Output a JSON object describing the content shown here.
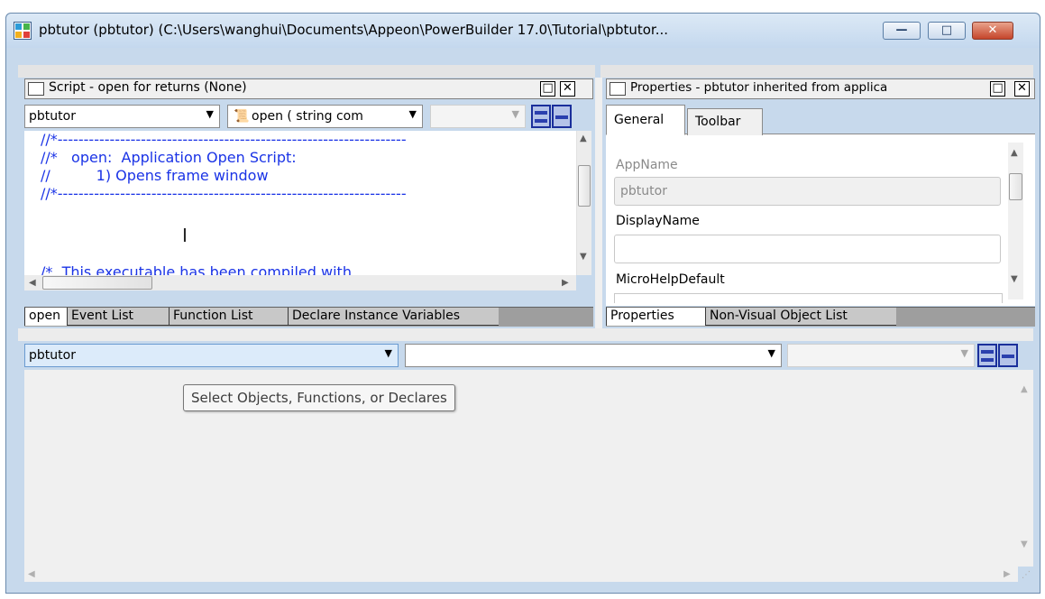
{
  "window": {
    "title": "pbtutor (pbtutor) (C:\\Users\\wanghui\\Documents\\Appeon\\PowerBuilder 17.0\\Tutorial\\pbtutor...",
    "minimize_glyph": "—",
    "maximize_glyph": "□",
    "close_glyph": "✕"
  },
  "script_pane": {
    "title": "Script - open for  returns (None)",
    "object_combo": "pbtutor",
    "event_combo": "open ( string com",
    "third_combo": "",
    "code_lines": [
      "//*-------------------------------------------------------------------",
      "//*   open:  Application Open Script:",
      "//          1) Opens frame window",
      "//*-------------------------------------------------------------------",
      "",
      "/*  This executable has been compiled with"
    ],
    "tabs": [
      "open",
      "Event List",
      "Function List",
      "Declare Instance Variables"
    ]
  },
  "properties_pane": {
    "title": "Properties - pbtutor  inherited  from  applica",
    "tabs": [
      "General",
      "Toolbar"
    ],
    "fields": [
      {
        "label": "AppName",
        "value": "pbtutor"
      },
      {
        "label": "DisplayName",
        "value": ""
      },
      {
        "label": "MicroHelpDefault",
        "value": ""
      }
    ],
    "bottom_tabs": [
      "Properties",
      "Non-Visual Object List"
    ]
  },
  "lower_pane": {
    "object_combo": "pbtutor",
    "event_combo": "",
    "third_combo": "",
    "tooltip": "Select Objects, Functions, or Declares"
  },
  "colors": {
    "code_blue": "#1a33e6",
    "title_gradient_top": "#dce9f6",
    "title_gradient_bottom": "#c4d8ee",
    "close_red": "#c5452b"
  }
}
